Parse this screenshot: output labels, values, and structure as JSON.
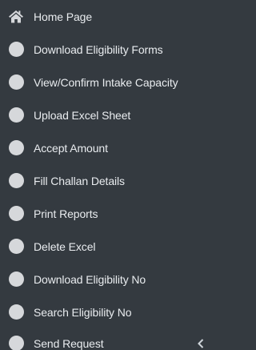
{
  "sidebar": {
    "items": [
      {
        "label": "Home Page",
        "icon": "home-icon"
      },
      {
        "label": "Download Eligibility Forms",
        "icon": "circle-icon"
      },
      {
        "label": "View/Confirm Intake Capacity",
        "icon": "circle-icon"
      },
      {
        "label": "Upload Excel Sheet",
        "icon": "circle-icon"
      },
      {
        "label": "Accept Amount",
        "icon": "circle-icon"
      },
      {
        "label": "Fill Challan Details",
        "icon": "circle-icon"
      },
      {
        "label": "Print Reports",
        "icon": "circle-icon"
      },
      {
        "label": "Delete Excel",
        "icon": "circle-icon"
      },
      {
        "label": "Download Eligibility No",
        "icon": "circle-icon"
      },
      {
        "label": "Search Eligibility No",
        "icon": "circle-icon"
      },
      {
        "label": "Send Request",
        "icon": "circle-icon",
        "expand_icon": "chevron-left-icon"
      }
    ]
  }
}
